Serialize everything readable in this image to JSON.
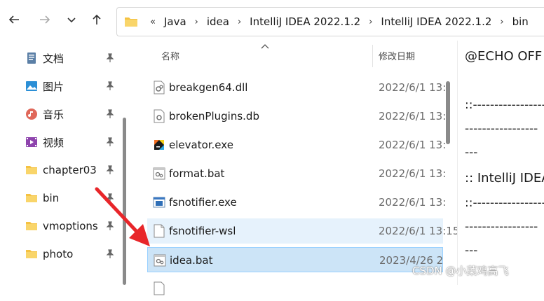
{
  "nav": {
    "back": "back-arrow-icon",
    "forward": "forward-arrow-icon",
    "recent": "chevron-down-icon",
    "up": "up-arrow-icon"
  },
  "address": {
    "overflow": "«",
    "crumbs": [
      "Java",
      "idea",
      "IntelliJ IDEA 2022.1.2",
      "IntelliJ IDEA 2022.1.2",
      "bin"
    ]
  },
  "sidebar": {
    "items": [
      {
        "label": "文档",
        "icon": "documents-icon"
      },
      {
        "label": "图片",
        "icon": "pictures-icon"
      },
      {
        "label": "音乐",
        "icon": "music-icon"
      },
      {
        "label": "视频",
        "icon": "videos-icon"
      },
      {
        "label": "chapter03",
        "icon": "folder-icon"
      },
      {
        "label": "bin",
        "icon": "folder-icon"
      },
      {
        "label": "vmoptions",
        "icon": "folder-icon"
      },
      {
        "label": "photo",
        "icon": "folder-icon"
      }
    ]
  },
  "columns": {
    "name": "名称",
    "modified": "修改日期"
  },
  "files": [
    {
      "name": "breakgen64.dll",
      "date": "2022/6/1 13:",
      "icon": "dll-file-icon"
    },
    {
      "name": "brokenPlugins.db",
      "date": "2022/6/1 13:",
      "icon": "generic-file-icon"
    },
    {
      "name": "elevator.exe",
      "date": "2022/6/1 13:",
      "icon": "exe-app-icon"
    },
    {
      "name": "format.bat",
      "date": "2022/6/1 13:",
      "icon": "bat-file-icon"
    },
    {
      "name": "fsnotifier.exe",
      "date": "2022/6/1 13:",
      "icon": "exe-window-icon"
    },
    {
      "name": "fsnotifier-wsl",
      "date": "2022/6/1 13:15",
      "icon": "blank-file-icon"
    },
    {
      "name": "idea.bat",
      "date": "2023/4/26 2",
      "icon": "bat-file-icon"
    }
  ],
  "preview": {
    "lines": [
      "@ECHO OFF",
      "::-----------------",
      "-----------------",
      "---",
      ":: IntelliJ IDEA",
      "::-----------------",
      "-----------------",
      "---"
    ]
  },
  "watermark": "CSDN @小菜鸡高飞",
  "colors": {
    "selected": "#cce4f7",
    "hover": "#e6f2fc",
    "arrow": "#e8262a",
    "folder": "#f5c242"
  }
}
